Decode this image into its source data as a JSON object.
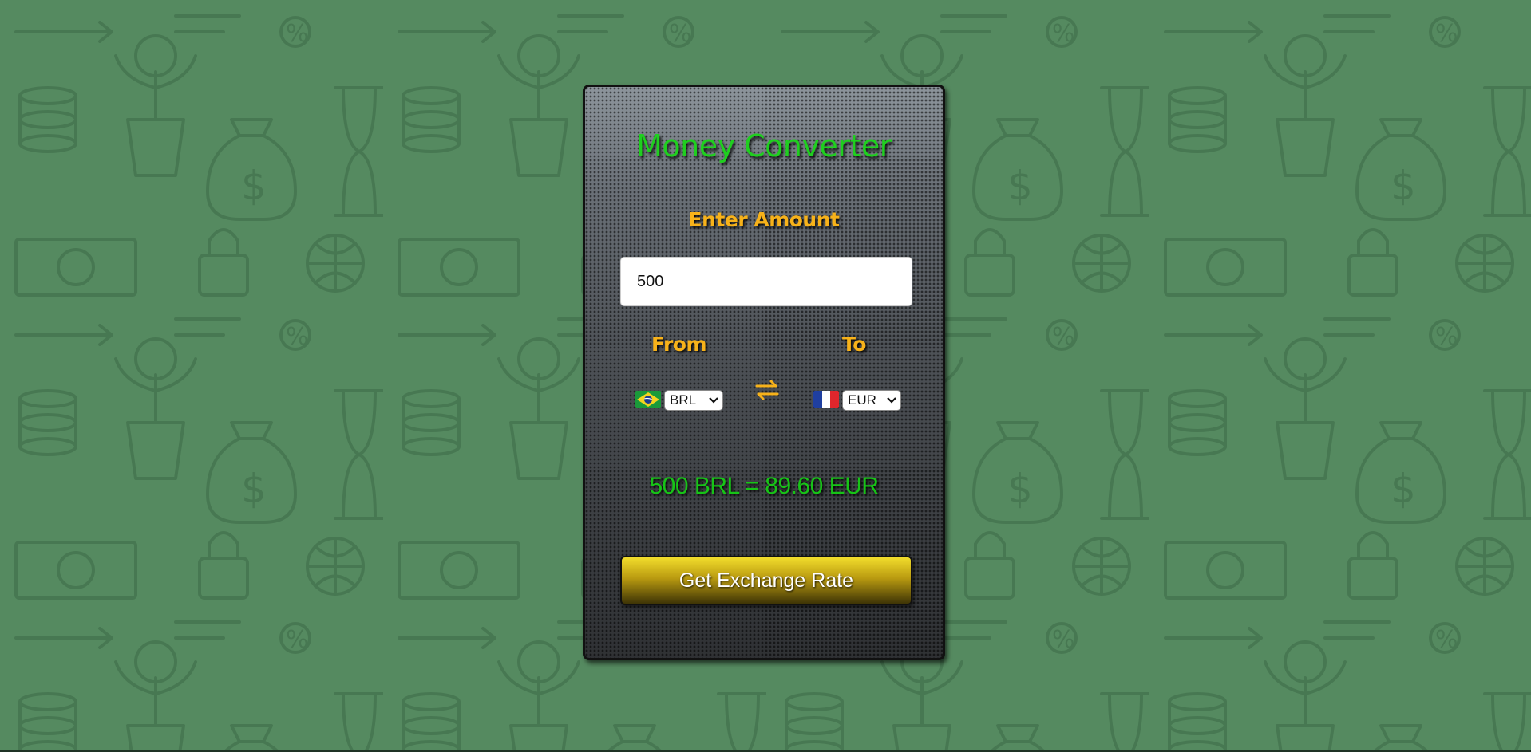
{
  "app": {
    "title": "Money Converter"
  },
  "amount": {
    "label": "Enter Amount",
    "value": "500"
  },
  "from": {
    "label": "From",
    "currency": "BRL",
    "flag_icon": "brazil-flag-icon"
  },
  "to": {
    "label": "To",
    "currency": "EUR",
    "flag_icon": "france-flag-icon"
  },
  "swap": {
    "icon": "swap-arrows-icon"
  },
  "result": {
    "text": "500 BRL = 89.60 EUR"
  },
  "button": {
    "label": "Get Exchange Rate"
  },
  "colors": {
    "background": "#558a60",
    "title": "#1fcf1f",
    "labels": "#f7b21a",
    "result": "#17c417",
    "button_top": "#f2dd2c",
    "button_bottom": "#3e3406"
  }
}
